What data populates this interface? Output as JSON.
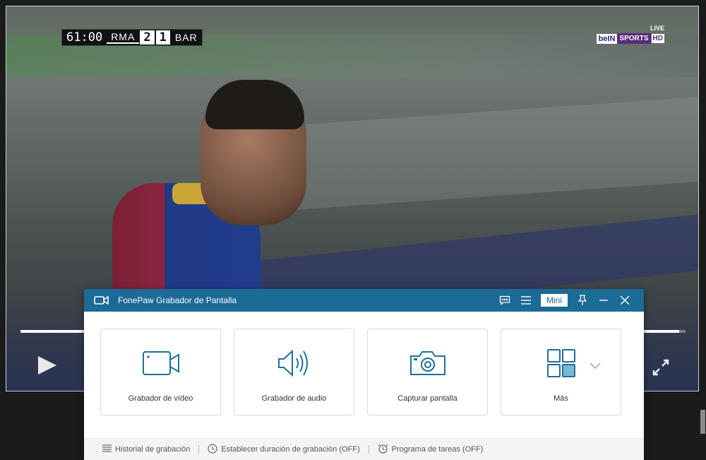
{
  "video": {
    "clock": "61:00",
    "home_team": "RMA",
    "home_score": "2",
    "away_score": "1",
    "away_team": "BAR",
    "broadcaster_live": "LIVE",
    "broadcaster_brand": "beIN",
    "broadcaster_sports": "SPORTS",
    "broadcaster_hd": "HD",
    "progress_fraction": 0.99
  },
  "app": {
    "title": "FonePaw Grabador de Pantalla",
    "mini_label": "Mini",
    "accent_color": "#1c6a96",
    "icon_color": "#1f6f9c",
    "cards": [
      {
        "label": "Grabador de vídeo",
        "icon": "video-camera-icon"
      },
      {
        "label": "Grabador de audio",
        "icon": "speaker-icon"
      },
      {
        "label": "Capturar pantalla",
        "icon": "camera-icon"
      },
      {
        "label": "Más",
        "icon": "grid-icon"
      }
    ],
    "footer": {
      "history": "Historial de grabación",
      "duration": "Establecer duración de grabación (OFF)",
      "schedule": "Programa de tareas (OFF)"
    }
  }
}
